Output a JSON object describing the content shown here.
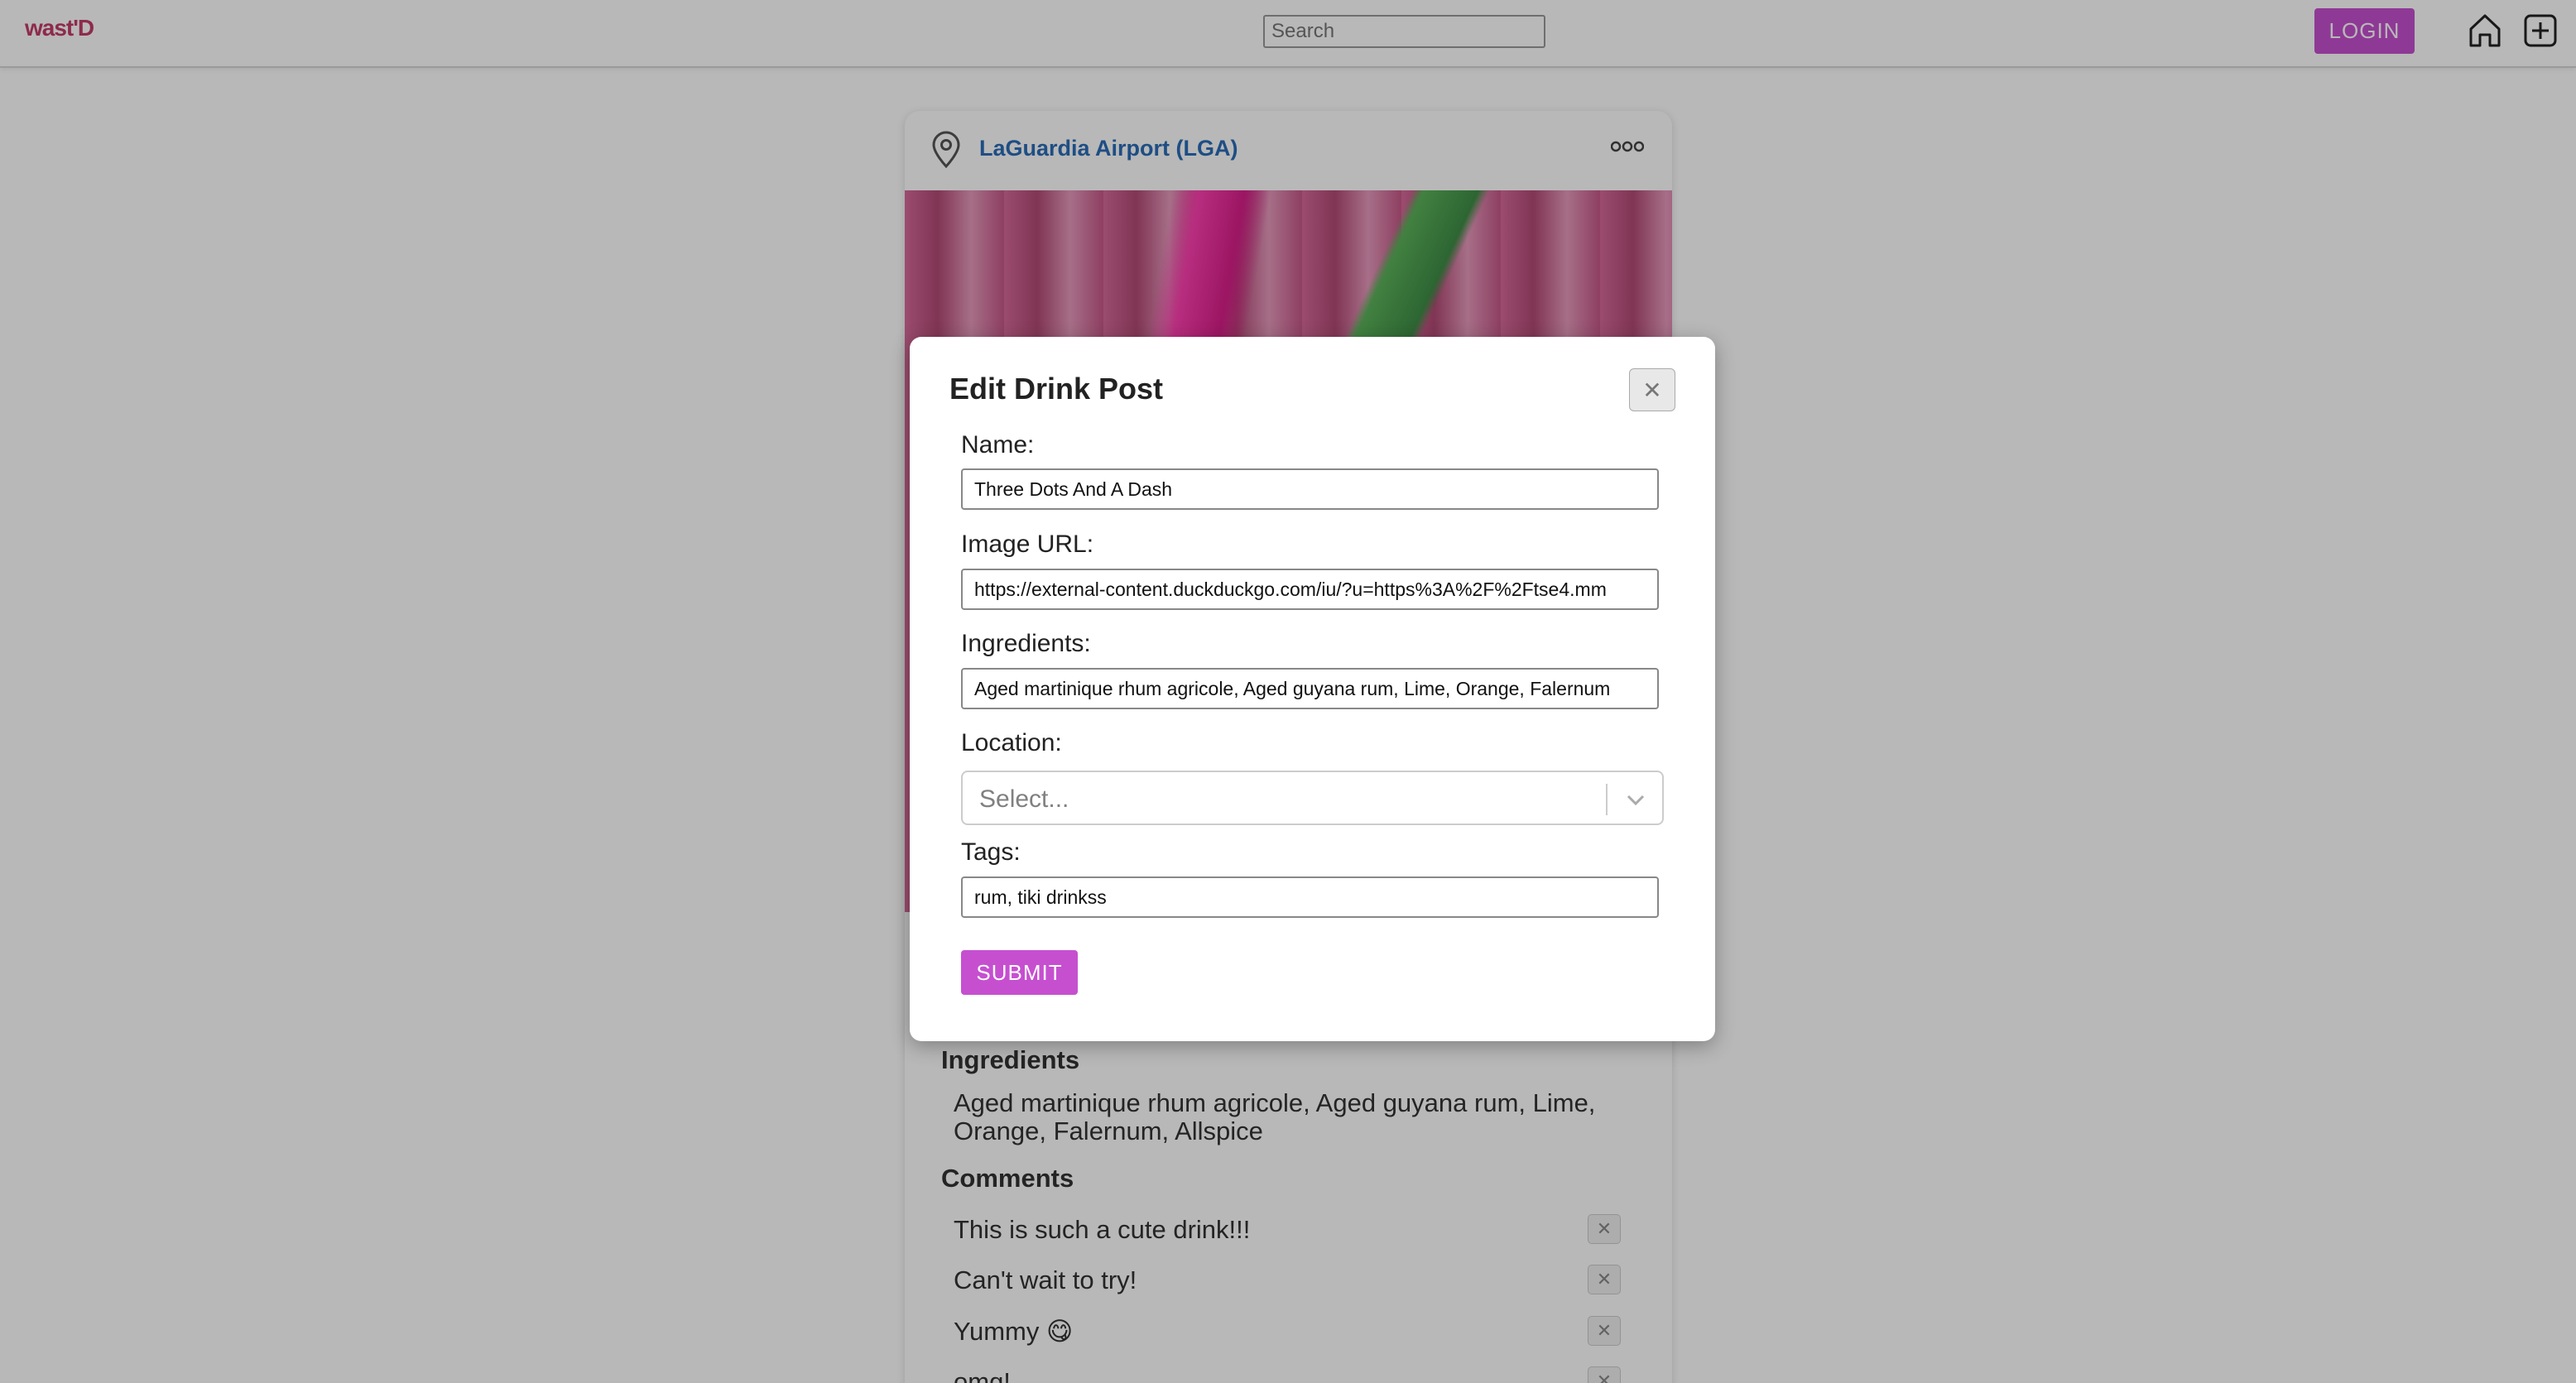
{
  "navbar": {
    "logo": "wast'D",
    "search_placeholder": "Search",
    "login_label": "LOGIN",
    "home_icon": "home-icon",
    "add_icon": "plus-square-icon"
  },
  "post": {
    "location": "LaGuardia Airport (LGA)",
    "ingredients_title": "Ingredients",
    "ingredients_text": "Aged martinique rhum agricole, Aged guyana rum, Lime, Orange, Falernum, Allspice",
    "comments_title": "Comments",
    "comments": [
      {
        "text": "This is such a cute drink!!!"
      },
      {
        "text": "Can't wait to try!"
      },
      {
        "text": "Yummy 😋"
      },
      {
        "text": "omg!"
      }
    ],
    "delete_label": "✕"
  },
  "modal": {
    "title": "Edit Drink Post",
    "close_label": "✕",
    "name_label": "Name:",
    "name_value": "Three Dots And A Dash",
    "image_url_label": "Image URL:",
    "image_url_value": "https://external-content.duckduckgo.com/iu/?u=https%3A%2F%2Ftse4.mm",
    "ingredients_label": "Ingredients:",
    "ingredients_value": "Aged martinique rhum agricole, Aged guyana rum, Lime, Orange, Falernum",
    "location_label": "Location:",
    "location_placeholder": "Select...",
    "tags_label": "Tags:",
    "tags_value": "rum, tiki drinkss",
    "submit_label": "SUBMIT"
  },
  "colors": {
    "accent": "#c64fd0",
    "link": "#2a6db8",
    "logo": "#c53b6a"
  }
}
